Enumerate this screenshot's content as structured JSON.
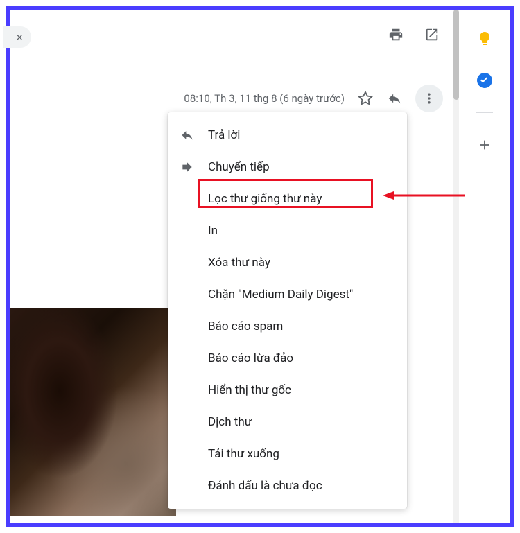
{
  "tab": {
    "close_label": "×",
    "tab_text": ""
  },
  "timestamp": "08:10, Th 3, 11 thg 8 (6 ngày trước)",
  "menu": {
    "items": [
      {
        "label": "Trả lời",
        "icon": "reply-icon"
      },
      {
        "label": "Chuyển tiếp",
        "icon": "forward-icon"
      },
      {
        "label": "Lọc thư giống thư này",
        "icon": ""
      },
      {
        "label": "In",
        "icon": ""
      },
      {
        "label": "Xóa thư này",
        "icon": ""
      },
      {
        "label": "Chặn \"Medium Daily Digest\"",
        "icon": ""
      },
      {
        "label": "Báo cáo spam",
        "icon": ""
      },
      {
        "label": "Báo cáo lừa đảo",
        "icon": ""
      },
      {
        "label": "Hiển thị thư gốc",
        "icon": ""
      },
      {
        "label": "Dịch thư",
        "icon": ""
      },
      {
        "label": "Tải thư xuống",
        "icon": ""
      },
      {
        "label": "Đánh dấu là chưa đọc",
        "icon": ""
      }
    ]
  },
  "highlight": {
    "target_index": 2
  },
  "sidepanel": {
    "items": [
      {
        "name": "keep-icon",
        "color": "#fbbc04"
      },
      {
        "name": "tasks-icon",
        "color": "#1a73e8"
      }
    ]
  }
}
